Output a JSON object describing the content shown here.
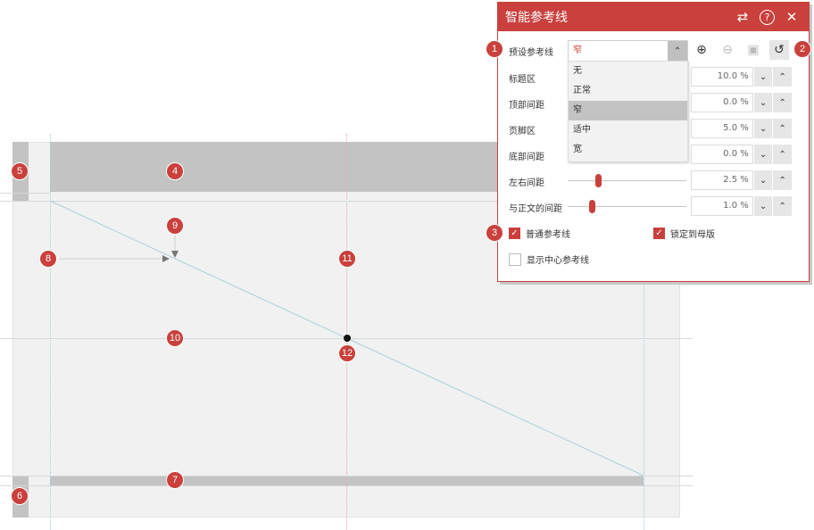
{
  "dialog": {
    "title": "智能参考线",
    "header_icons": {
      "sync": "⇄",
      "help": "?",
      "close": "✕"
    },
    "preset": {
      "label": "预设参考线",
      "value": "窄",
      "options": [
        "无",
        "正常",
        "窄",
        "适中",
        "宽"
      ],
      "selected_index": 2
    },
    "tool_buttons": {
      "add": "⊕",
      "remove": "⊖",
      "save": "▣",
      "reset": "↺"
    },
    "rows": [
      {
        "label": "标题区",
        "value": "10.0 %"
      },
      {
        "label": "顶部间距",
        "value": "0.0 %"
      },
      {
        "label": "页脚区",
        "value": "5.0 %"
      },
      {
        "label": "底部间距",
        "value": "0.0 %"
      },
      {
        "label": "左右间距",
        "value": "2.5 %",
        "slider": 0.25
      },
      {
        "label": "与正文的间距",
        "value": "1.0 %",
        "slider": 0.2
      }
    ],
    "spin_down": "⌄",
    "spin_up": "⌃",
    "checkboxes": [
      {
        "label": "普通参考线",
        "checked": true
      },
      {
        "label": "锁定到母版",
        "checked": true
      },
      {
        "label": "显示中心参考线",
        "checked": false
      }
    ]
  },
  "badges": [
    "1",
    "2",
    "3",
    "4",
    "5",
    "6",
    "7",
    "8",
    "9",
    "10",
    "11",
    "12"
  ],
  "colors": {
    "accent": "#c9403d",
    "zone": "#c3c3c3",
    "canvas": "#f1f1f1"
  }
}
